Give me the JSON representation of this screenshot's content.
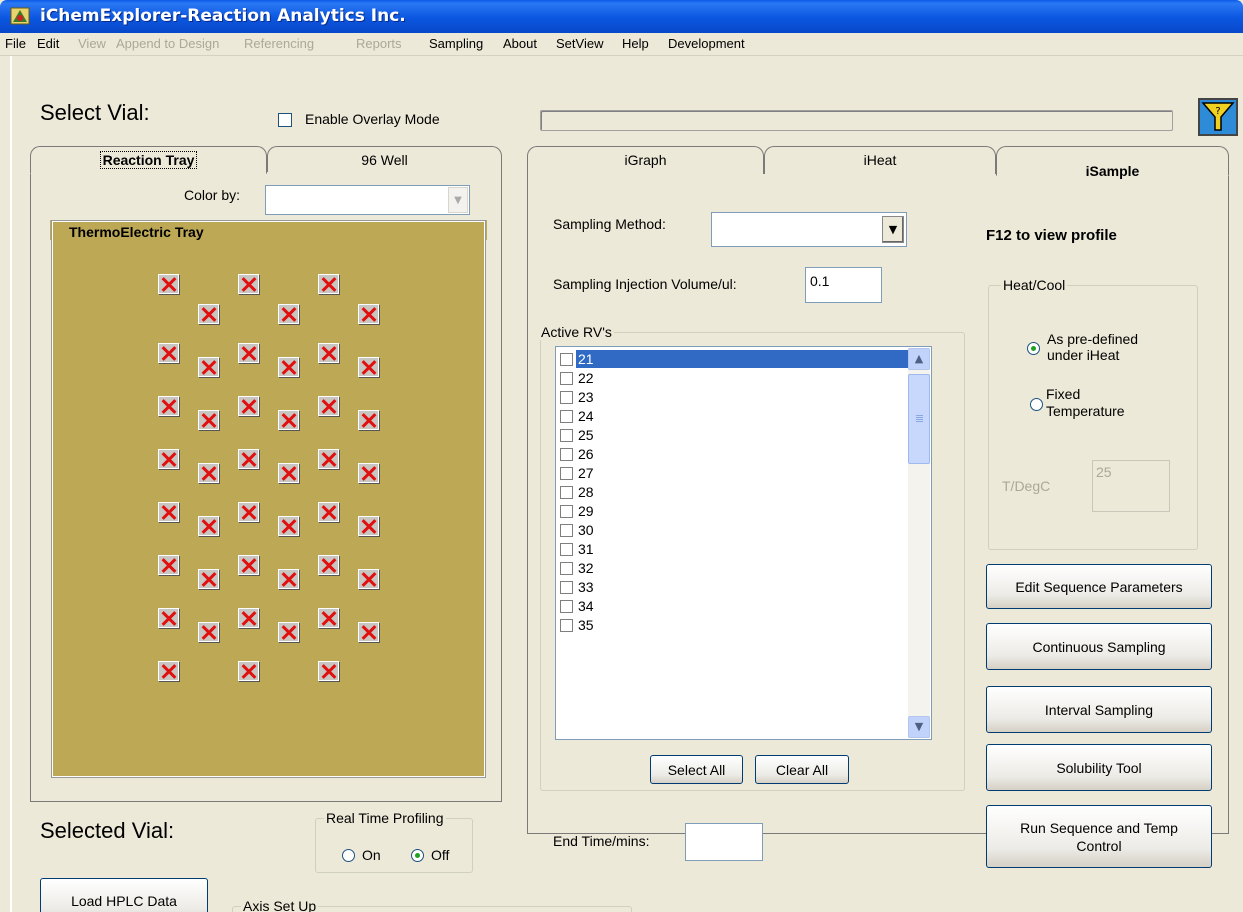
{
  "window": {
    "title": "iChemExplorer-Reaction Analytics Inc."
  },
  "menu": {
    "items": [
      {
        "label": "File",
        "enabled": true
      },
      {
        "label": "Edit",
        "enabled": true
      },
      {
        "label": "View",
        "enabled": false
      },
      {
        "label": "Append to Design",
        "enabled": false
      },
      {
        "label": "Referencing",
        "enabled": false
      },
      {
        "label": "Reports",
        "enabled": false
      },
      {
        "label": "Sampling",
        "enabled": true
      },
      {
        "label": "About",
        "enabled": true
      },
      {
        "label": "SetView",
        "enabled": true
      },
      {
        "label": "Help",
        "enabled": true
      },
      {
        "label": "Development",
        "enabled": true
      }
    ]
  },
  "left": {
    "select_vial": "Select Vial:",
    "overlay_label": "Enable Overlay Mode",
    "overlay_checked": false,
    "tabs": [
      {
        "label": "Reaction Tray",
        "active": true
      },
      {
        "label": "96 Well",
        "active": false
      }
    ],
    "color_by_label": "Color by:",
    "color_by_value": "",
    "tray_title": "ThermoElectric Tray",
    "tray_vial_count": 45,
    "selected_vial": "Selected Vial:",
    "realtime": {
      "label": "Real Time Profiling",
      "on": "On",
      "off": "Off",
      "selected": "Off"
    },
    "load_hplc": "Load HPLC Data",
    "axis_setup": "Axis Set Up"
  },
  "right": {
    "tabs": [
      {
        "label": "iGraph",
        "active": false
      },
      {
        "label": "iHeat",
        "active": false
      },
      {
        "label": "iSample",
        "active": true
      }
    ],
    "sampling_method_label": "Sampling Method:",
    "sampling_method_value": "",
    "injection_label": "Sampling Injection Volume/ul:",
    "injection_value": "0.1",
    "f12": "F12 to view profile",
    "active_rvs": {
      "label": "Active RV's",
      "items": [
        "21",
        "22",
        "23",
        "24",
        "25",
        "26",
        "27",
        "28",
        "29",
        "30",
        "31",
        "32",
        "33",
        "34",
        "35"
      ],
      "selected": "21"
    },
    "select_all": "Select All",
    "clear_all": "Clear All",
    "end_time_label": "End Time/mins:",
    "end_time_value": "",
    "heatcool": {
      "label": "Heat/Cool",
      "opt1": "As pre-defined under iHeat",
      "opt2": "Fixed Temperature",
      "selected": "As pre-defined under iHeat",
      "temp_label": "T/DegC",
      "temp_value": "25"
    },
    "buttons": {
      "edit_seq": "Edit Sequence Parameters",
      "continuous": "Continuous Sampling",
      "interval": "Interval Sampling",
      "solubility": "Solubility Tool",
      "run_seq": "Run Sequence and Temp Control"
    }
  },
  "colors": {
    "titlebar": "#0a5ae8",
    "tray": "#bda856",
    "selection": "#316ac5",
    "vial_x": "#e01010"
  }
}
